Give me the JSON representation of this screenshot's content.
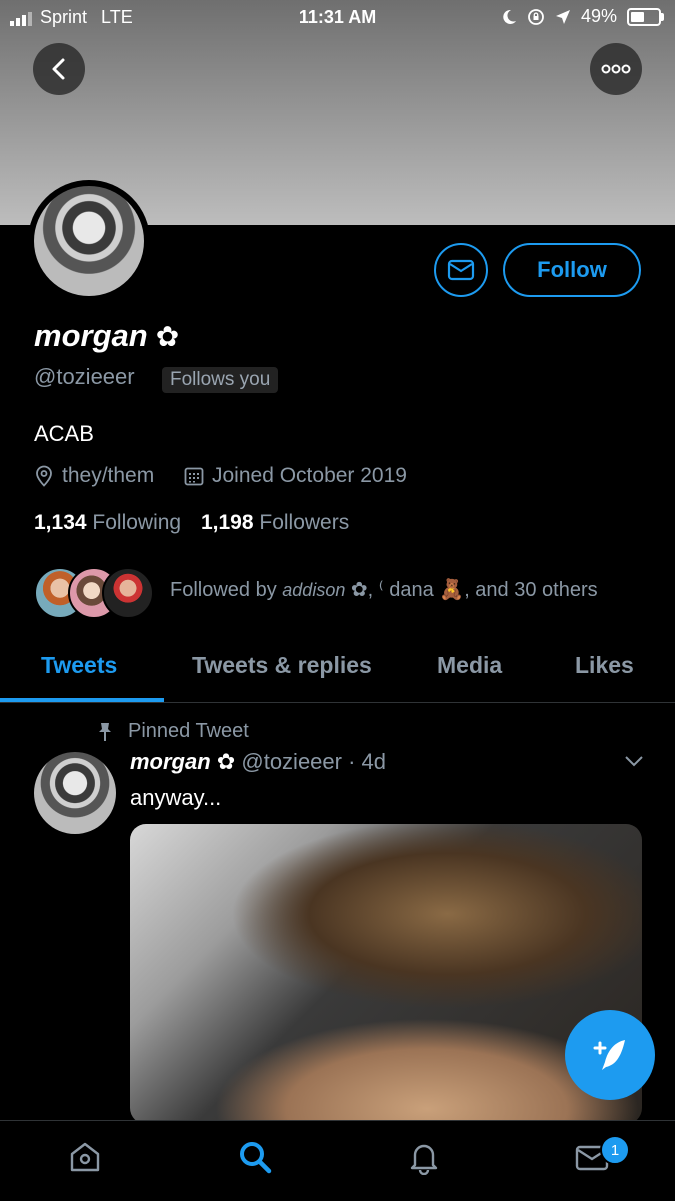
{
  "status_bar": {
    "carrier": "Sprint",
    "network": "LTE",
    "time": "11:31 AM",
    "battery": "49%",
    "battery_level": 0.49
  },
  "profile": {
    "display_name": "morgan",
    "name_emoji": "✿",
    "handle": "@tozieeer",
    "follows_you": "Follows you",
    "bio": "ACAB",
    "location": "they/them",
    "joined": "Joined October 2019",
    "following_count": "1,134",
    "following_label": "Following",
    "followers_count": "1,198",
    "followers_label": "Followers",
    "followed_by_prefix": "Followed by",
    "followed_by_name1": "addison",
    "followed_by_mid": "✿, ⁽ dana 🧸, and 30 others"
  },
  "actions": {
    "follow_label": "Follow"
  },
  "tabs": [
    "Tweets",
    "Tweets & replies",
    "Media",
    "Likes"
  ],
  "active_tab": "Tweets",
  "pinned_tweet": {
    "label": "Pinned Tweet",
    "author": "morgan",
    "author_emoji": "✿",
    "handle_time": "@tozieeer · 4d",
    "text": "anyway..."
  },
  "bottom_nav": {
    "messages_badge": "1"
  },
  "colors": {
    "accent": "#1d9bf0",
    "secondary_text": "#8b98a5",
    "background": "#000000"
  }
}
